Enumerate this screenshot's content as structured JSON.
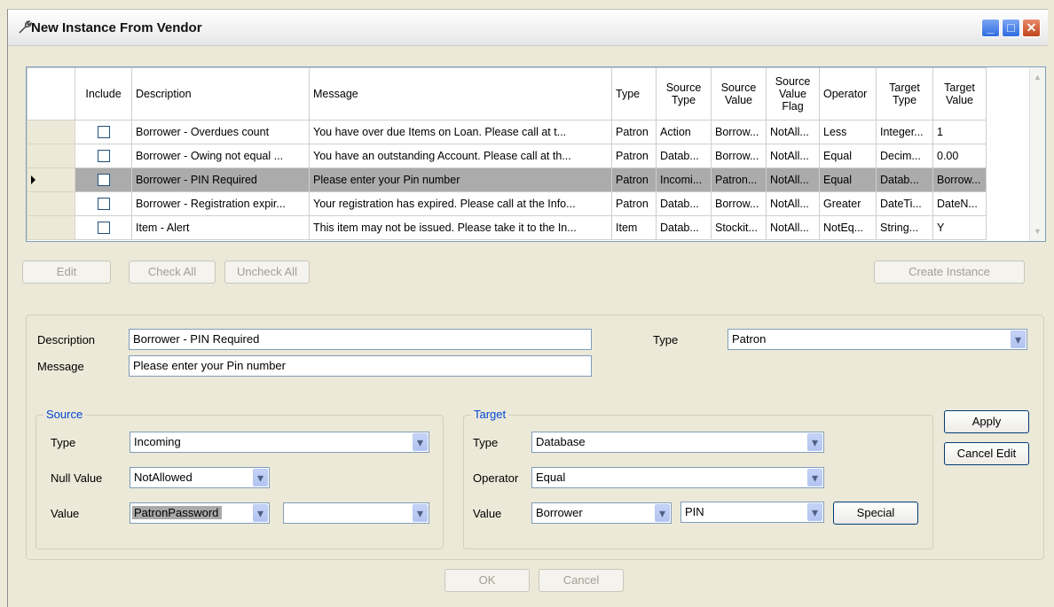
{
  "window": {
    "title": "New Instance From Vendor"
  },
  "grid": {
    "headers": {
      "include": "Include",
      "description": "Description",
      "message": "Message",
      "type": "Type",
      "source_type": "Source Type",
      "source_value": "Source Value",
      "source_value_flag": "Source Value Flag",
      "operator": "Operator",
      "target_type": "Target Type",
      "target_value": "Target Value"
    },
    "rows": [
      {
        "description": "Borrower - Overdues count",
        "message": "You have over due  Items on Loan. Please call at t...",
        "type": "Patron",
        "source_type": "Action",
        "source_value": "Borrow...",
        "flag": "NotAll...",
        "operator": "Less",
        "target_type": "Integer...",
        "target_value": "1"
      },
      {
        "description": "Borrower - Owing not equal ...",
        "message": "You have an outstanding Account. Please call at th...",
        "type": "Patron",
        "source_type": "Datab...",
        "source_value": "Borrow...",
        "flag": "NotAll...",
        "operator": "Equal",
        "target_type": "Decim...",
        "target_value": "0.00"
      },
      {
        "description": "Borrower - PIN Required",
        "message": "Please enter your Pin number",
        "type": "Patron",
        "source_type": "Incomi...",
        "source_value": "Patron...",
        "flag": "NotAll...",
        "operator": "Equal",
        "target_type": "Datab...",
        "target_value": "Borrow..."
      },
      {
        "description": "Borrower - Registration expir...",
        "message": "Your registration has expired. Please call at the Info...",
        "type": "Patron",
        "source_type": "Datab...",
        "source_value": "Borrow...",
        "flag": "NotAll...",
        "operator": "Greater",
        "target_type": "DateTi...",
        "target_value": "DateN..."
      },
      {
        "description": "Item - Alert",
        "message": "This item may not be issued. Please take it to the In...",
        "type": "Item",
        "source_type": "Datab...",
        "source_value": "Stockit...",
        "flag": "NotAll...",
        "operator": "NotEq...",
        "target_type": "String...",
        "target_value": "Y"
      }
    ]
  },
  "buttons": {
    "edit": "Edit",
    "check_all": "Check All",
    "uncheck_all": "Uncheck All",
    "create_instance": "Create Instance",
    "apply": "Apply",
    "cancel_edit": "Cancel Edit",
    "special": "Special",
    "ok": "OK",
    "cancel": "Cancel"
  },
  "form": {
    "description_label": "Description",
    "description_value": "Borrower - PIN Required",
    "message_label": "Message",
    "message_value": "Please enter your Pin number",
    "type_label": "Type",
    "type_value": "Patron"
  },
  "source": {
    "title": "Source",
    "type_label": "Type",
    "type_value": "Incoming",
    "null_label": "Null Value",
    "null_value": "NotAllowed",
    "value_label": "Value",
    "value_value": "PatronPassword",
    "value2_value": ""
  },
  "target": {
    "title": "Target",
    "type_label": "Type",
    "type_value": "Database",
    "operator_label": "Operator",
    "operator_value": "Equal",
    "value_label": "Value",
    "value_value": "Borrower",
    "value2_value": "PIN"
  },
  "colors": {
    "selected_row": "#ababab",
    "group_title": "#0046d5",
    "window_bg": "#ece9d8"
  }
}
